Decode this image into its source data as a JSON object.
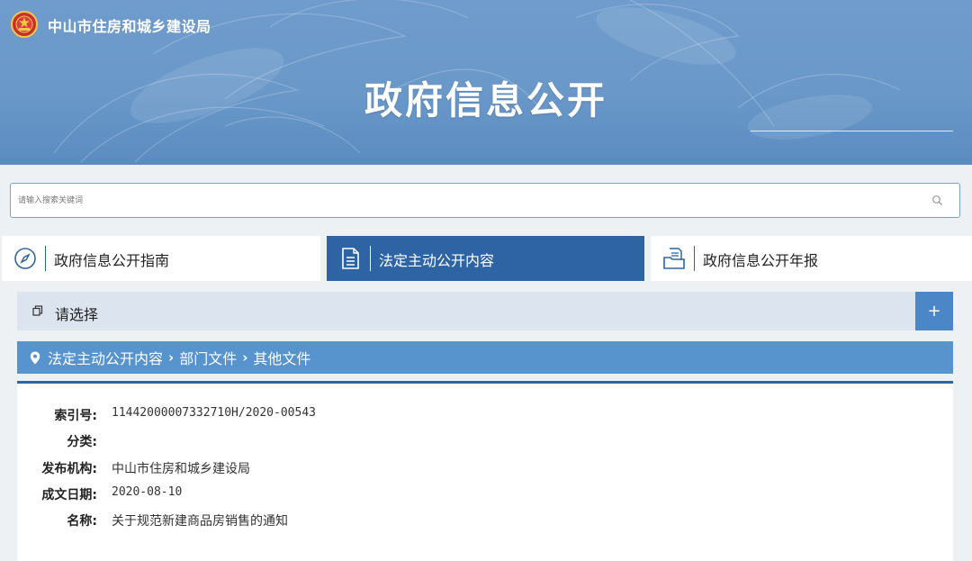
{
  "header": {
    "org_name": "中山市住房和城乡建设局",
    "title": "政府信息公开"
  },
  "search": {
    "placeholder": "请输入搜索关键词"
  },
  "tabs": [
    {
      "label": "政府信息公开指南",
      "icon": "compass-icon",
      "active": false
    },
    {
      "label": "法定主动公开内容",
      "icon": "document-list-icon",
      "active": true
    },
    {
      "label": "政府信息公开年报",
      "icon": "folder-document-icon",
      "active": false
    }
  ],
  "selector": {
    "label": "请选择",
    "expand_label": "+"
  },
  "breadcrumb": [
    "法定主动公开内容",
    "部门文件",
    "其他文件"
  ],
  "detail": {
    "rows": [
      {
        "key": "索引号:",
        "value": "11442000007332710H/2020-00543"
      },
      {
        "key": "分类:",
        "value": ""
      },
      {
        "key": "发布机构:",
        "value": "中山市住房和城乡建设局"
      },
      {
        "key": "成文日期:",
        "value": "2020-08-10"
      },
      {
        "key": "名称:",
        "value": "关于规范新建商品房销售的通知"
      }
    ]
  },
  "colors": {
    "banner": "#6a98c9",
    "active_tab": "#2f64a4",
    "breadcrumb": "#5793cc",
    "accent": "#4b86c6"
  }
}
